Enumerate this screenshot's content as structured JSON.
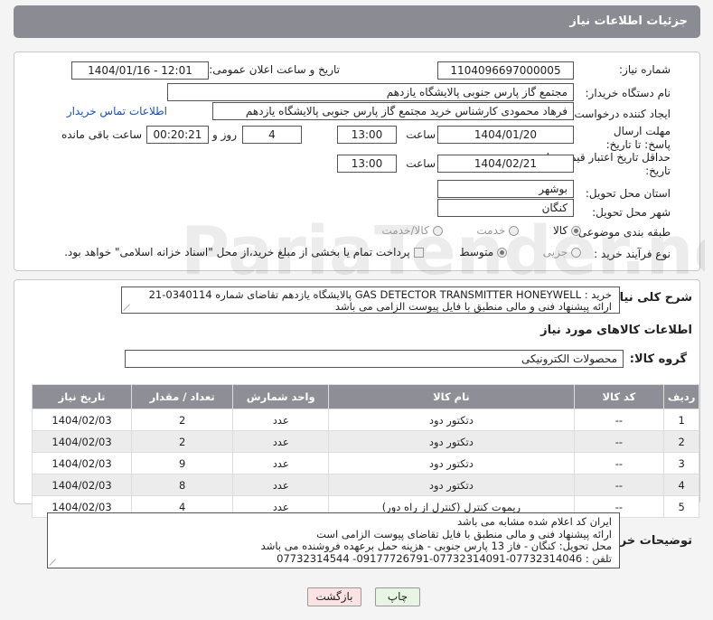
{
  "header": {
    "title": "جزئیات اطلاعات نیاز"
  },
  "fields": {
    "need_number_label": "شماره نیاز:",
    "need_number": "1104096697000005",
    "announce_datetime_label": "تاریخ و ساعت اعلان عمومی:",
    "announce_datetime": "1404/01/16 - 12:01",
    "buyer_org_label": "نام دستگاه خریدار:",
    "buyer_org": "مجتمع گاز پارس جنوبی  پالایشگاه یازدهم",
    "requester_label": "ایجاد کننده درخواست:",
    "requester": "فرهاد محمودی کارشناس خرید مجتمع گاز پارس جنوبی  پالایشگاه یازدهم",
    "buyer_contact_link": "اطلاعات تماس خریدار",
    "send_deadline_label": "مهلت ارسال پاسخ: تا تاریخ:",
    "send_deadline_date": "1404/01/20",
    "time_label": "ساعت",
    "send_deadline_time": "13:00",
    "days_value": "4",
    "days_label": "روز و",
    "remaining_time": "00:20:21",
    "remaining_label": "ساعت باقی مانده",
    "price_validity_label": "حداقل تاریخ اعتبار قیمت: تا تاریخ:",
    "price_validity_date": "1404/02/21",
    "price_validity_time": "13:00",
    "province_label": "استان محل تحویل:",
    "province": "بوشهر",
    "city_label": "شهر محل تحویل:",
    "city": "کنگان",
    "category_label": "طبقه بندی موضوعی:",
    "category_options": [
      "کالا",
      "خدمت",
      "کالا/خدمت"
    ],
    "purchase_type_label": "نوع فرآیند خرید :",
    "purchase_type_options": [
      "جزیی",
      "متوسط"
    ],
    "payment_note": "پرداخت تمام یا بخشی از مبلغ خرید،از محل \"اسناد خزانه اسلامی\" خواهد بود."
  },
  "description": {
    "label": "شرح کلی نیاز:",
    "line1": "خرید :  GAS DETECTOR TRANSMITTER HONEYWELL  پالایشگاه یازدهم تقاضای شماره 0340114-21",
    "line2": "ارائه پیشنهاد فنی و مالی منطبق با فایل پیوست الزامی می باشد"
  },
  "goods": {
    "section_title": "اطلاعات کالاهای مورد نیاز",
    "group_label": "گروه کالا:",
    "group_value": "محصولات الکترونیکی",
    "columns": [
      "ردیف",
      "کد کالا",
      "نام کالا",
      "واحد شمارش",
      "تعداد / مقدار",
      "تاریخ نیاز"
    ],
    "rows": [
      {
        "idx": "1",
        "code": "--",
        "name": "دتکتور دود",
        "unit": "عدد",
        "qty": "2",
        "date": "1404/02/03"
      },
      {
        "idx": "2",
        "code": "--",
        "name": "دتکتور دود",
        "unit": "عدد",
        "qty": "2",
        "date": "1404/02/03"
      },
      {
        "idx": "3",
        "code": "--",
        "name": "دتکتور دود",
        "unit": "عدد",
        "qty": "9",
        "date": "1404/02/03"
      },
      {
        "idx": "4",
        "code": "--",
        "name": "دتکتور دود",
        "unit": "عدد",
        "qty": "8",
        "date": "1404/02/03"
      },
      {
        "idx": "5",
        "code": "--",
        "name": "ریموت کنترل (کنترل از راه دور)",
        "unit": "عدد",
        "qty": "4",
        "date": "1404/02/03"
      }
    ]
  },
  "buyer_notes": {
    "label": "توضیحات خریدار:",
    "lines": [
      "ایران کد اعلام شده مشابه می باشد",
      "ارائه پیشنهاد فنی و مالی منطبق با فایل تقاضای پیوست الزامی است",
      "محل تحویل: کنگان - فاز 13 پارس جنوبی - هزینه حمل برعهده فروشنده می باشد",
      "تلفن : 07732314046-07732314091-09177726791- 07732314544"
    ]
  },
  "buttons": {
    "print": "چاپ",
    "back": "بازگشت"
  },
  "colors": {
    "header_bg": "#8b8b94",
    "link": "#1a4fbf",
    "table_header": "#8e8e96",
    "back_button": "#fbe3e3",
    "print_button": "#e8f5e4"
  }
}
